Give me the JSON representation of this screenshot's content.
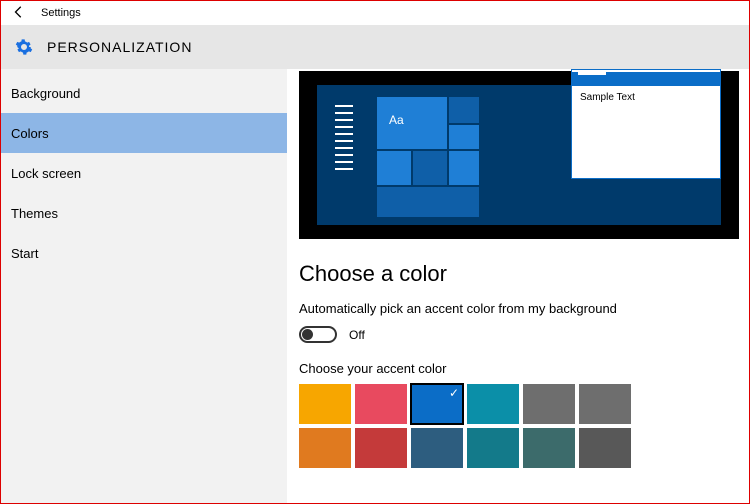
{
  "titlebar": {
    "title": "Settings"
  },
  "header": {
    "title": "PERSONALIZATION"
  },
  "sidebar": {
    "items": [
      {
        "label": "Background",
        "selected": false
      },
      {
        "label": "Colors",
        "selected": true
      },
      {
        "label": "Lock screen",
        "selected": false
      },
      {
        "label": "Themes",
        "selected": false
      },
      {
        "label": "Start",
        "selected": false
      }
    ]
  },
  "preview": {
    "tile_text": "Aa",
    "window_text": "Sample Text"
  },
  "main": {
    "section_title": "Choose a color",
    "auto_pick_label": "Automatically pick an accent color from my background",
    "toggle_state": "Off",
    "accent_label": "Choose your accent color",
    "swatches": [
      {
        "color": "#f7a600",
        "selected": false
      },
      {
        "color": "#e84a5f",
        "selected": false
      },
      {
        "color": "#0b6dc7",
        "selected": true
      },
      {
        "color": "#0b8fa8",
        "selected": false
      },
      {
        "color": "#6e6e6e",
        "selected": false
      },
      {
        "color": "#6e6e6e",
        "selected": false
      },
      {
        "color": "#e07a1f",
        "selected": false
      },
      {
        "color": "#c43a3a",
        "selected": false
      },
      {
        "color": "#2d5d7f",
        "selected": false
      },
      {
        "color": "#137a8a",
        "selected": false
      },
      {
        "color": "#3c6b6b",
        "selected": false
      },
      {
        "color": "#585858",
        "selected": false
      }
    ]
  }
}
